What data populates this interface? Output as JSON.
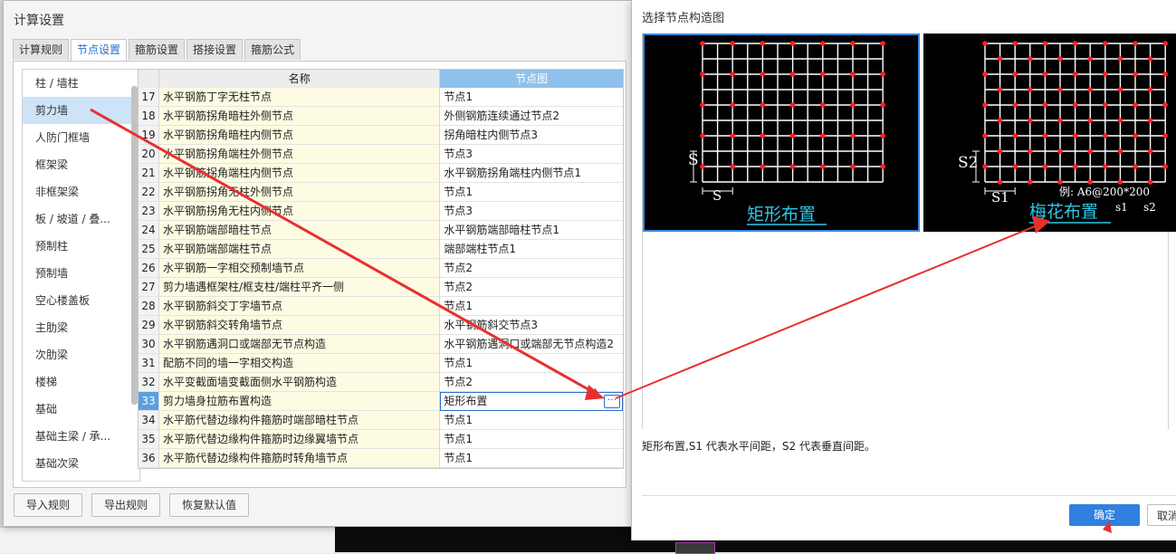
{
  "main_dialog": {
    "title": "计算设置",
    "tabs": [
      {
        "label": "计算规则"
      },
      {
        "label": "节点设置"
      },
      {
        "label": "箍筋设置"
      },
      {
        "label": "搭接设置"
      },
      {
        "label": "箍筋公式"
      }
    ],
    "active_tab": "节点设置",
    "categories": [
      {
        "label": "柱 / 墙柱"
      },
      {
        "label": "剪力墙"
      },
      {
        "label": "人防门框墙"
      },
      {
        "label": "框架梁"
      },
      {
        "label": "非框架梁"
      },
      {
        "label": "板 / 坡道 / 叠..."
      },
      {
        "label": "预制柱"
      },
      {
        "label": "预制墙"
      },
      {
        "label": "空心楼盖板"
      },
      {
        "label": "主肋梁"
      },
      {
        "label": "次肋梁"
      },
      {
        "label": "楼梯"
      },
      {
        "label": "基础"
      },
      {
        "label": "基础主梁 / 承..."
      },
      {
        "label": "基础次梁"
      }
    ],
    "selected_category": "剪力墙",
    "grid": {
      "header_name": "名称",
      "header_node": "节点图",
      "rows": [
        {
          "num": "17",
          "name": "水平钢筋丁字无柱节点",
          "node": "节点1"
        },
        {
          "num": "18",
          "name": "水平钢筋拐角暗柱外侧节点",
          "node": "外侧钢筋连续通过节点2"
        },
        {
          "num": "19",
          "name": "水平钢筋拐角暗柱内侧节点",
          "node": "拐角暗柱内侧节点3"
        },
        {
          "num": "20",
          "name": "水平钢筋拐角端柱外侧节点",
          "node": "节点3"
        },
        {
          "num": "21",
          "name": "水平钢筋拐角端柱内侧节点",
          "node": "水平钢筋拐角端柱内侧节点1"
        },
        {
          "num": "22",
          "name": "水平钢筋拐角无柱外侧节点",
          "node": "节点1"
        },
        {
          "num": "23",
          "name": "水平钢筋拐角无柱内侧节点",
          "node": "节点3"
        },
        {
          "num": "24",
          "name": "水平钢筋端部暗柱节点",
          "node": "水平钢筋端部暗柱节点1"
        },
        {
          "num": "25",
          "name": "水平钢筋端部端柱节点",
          "node": "端部端柱节点1"
        },
        {
          "num": "26",
          "name": "水平钢筋一字相交预制墙节点",
          "node": "节点2"
        },
        {
          "num": "27",
          "name": "剪力墙遇框架柱/框支柱/端柱平齐一侧",
          "node": "节点2"
        },
        {
          "num": "28",
          "name": "水平钢筋斜交丁字墙节点",
          "node": "节点1"
        },
        {
          "num": "29",
          "name": "水平钢筋斜交转角墙节点",
          "node": "水平钢筋斜交节点3"
        },
        {
          "num": "30",
          "name": "水平钢筋遇洞口或端部无节点构造",
          "node": "水平钢筋遇洞口或端部无节点构造2"
        },
        {
          "num": "31",
          "name": "配筋不同的墙一字相交构造",
          "node": "节点1"
        },
        {
          "num": "32",
          "name": "水平变截面墙变截面侧水平钢筋构造",
          "node": "节点2"
        },
        {
          "num": "33",
          "name": "剪力墙身拉筋布置构造",
          "node": "矩形布置"
        },
        {
          "num": "34",
          "name": "水平筋代替边缘构件箍筋时端部暗柱节点",
          "node": "节点1"
        },
        {
          "num": "35",
          "name": "水平筋代替边缘构件箍筋时边缘翼墙节点",
          "node": "节点1"
        },
        {
          "num": "36",
          "name": "水平筋代替边缘构件箍筋时转角墙节点",
          "node": "节点1"
        }
      ],
      "selected_row": "33",
      "ellipsis": "···"
    },
    "buttons": {
      "import": "导入规则",
      "export": "导出规则",
      "restore": "恢复默认值"
    }
  },
  "node_dialog": {
    "title": "选择节点构造图",
    "options": [
      {
        "label": "矩形布置",
        "dim_vertical": "S",
        "dim_horizontal": "S",
        "selected": true
      },
      {
        "label": "梅花布置",
        "dim_vertical": "S2",
        "dim_horizontal": "S1",
        "example": "例: A6@200*200",
        "example_s1": "s1",
        "example_s2": "s2",
        "selected": false
      }
    ],
    "description": "矩形布置,S1 代表水平间距，S2 代表垂直间距。",
    "ok_label": "确定",
    "cancel_label": "取消"
  },
  "colors": {
    "accent_blue": "#2f80e0",
    "header_blue": "#8ec1ec",
    "selection_blue": "#cde3f7",
    "name_cell_yellow": "#fdfce3",
    "annotation_red": "#e83030",
    "diagram_cyan": "#2fc6e6",
    "rebar_dot_red": "#ff2020"
  }
}
